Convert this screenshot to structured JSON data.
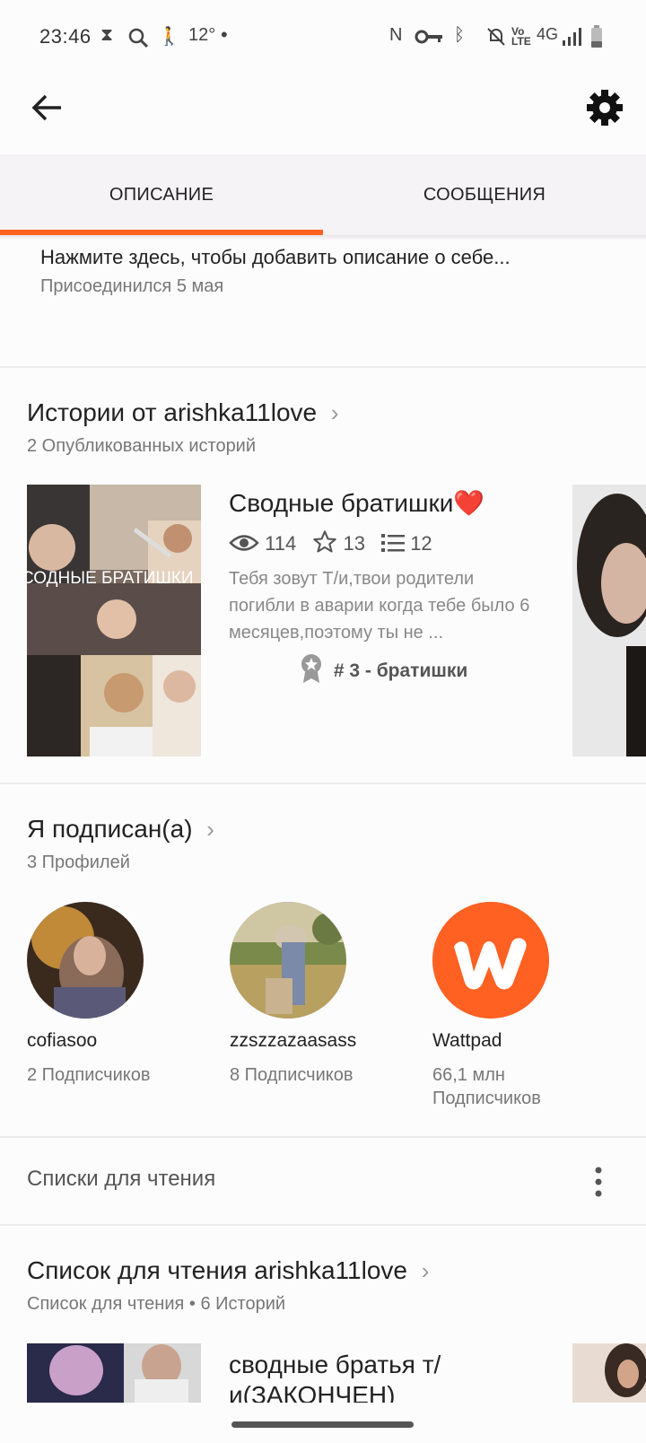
{
  "status_bar": {
    "time": "23:46",
    "temperature": "12°",
    "network": "4G",
    "icons": [
      "hourglass-icon",
      "search-icon",
      "walk-icon",
      "dot-icon",
      "nfc-icon",
      "key-icon",
      "bluetooth-icon",
      "mute-icon",
      "volte-icon",
      "signal-icon",
      "battery-icon"
    ]
  },
  "app_bar": {
    "back_icon": "arrow-left-icon",
    "settings_icon": "gear-icon"
  },
  "tabs": [
    {
      "label": "ОПИСАНИЕ",
      "active": true
    },
    {
      "label": "СООБЩЕНИЯ",
      "active": false
    }
  ],
  "accent_color": "#ff6122",
  "description": {
    "prompt": "Нажмите здесь, чтобы добавить описание о себе...",
    "joined": "Присоединился 5 мая"
  },
  "stories_section": {
    "title": "Истории от arishka11love",
    "subtitle": "2 Опубликованных историй",
    "story": {
      "cover_text": "СОДНЫЕ БРАТИШКИ",
      "title": "Сводные братишки❤️",
      "views": "114",
      "votes": "13",
      "parts": "12",
      "description": "Тебя зовут Т/и,твои родители погибли в аварии когда тебе было 6 месяцев,поэтому ты не ...",
      "rank": "# 3 - братишки"
    }
  },
  "following_section": {
    "title": "Я подписан(а)",
    "subtitle": "3 Профилей",
    "profiles": [
      {
        "name": "cofiasoo",
        "followers": "2 Подписчиков"
      },
      {
        "name": "zzszzazaasass",
        "followers": "8 Подписчиков"
      },
      {
        "name": "Wattpad",
        "followers_line1": "66,1 млн",
        "followers_line2": "Подписчиков"
      }
    ]
  },
  "reading_lists": {
    "label": "Списки для чтения"
  },
  "reading_list_section": {
    "title": "Список для чтения arishka11love",
    "subtitle": "Список для чтения • 6 Историй",
    "story_title": "сводные братья т/и(ЗАКОНЧЕН)"
  }
}
